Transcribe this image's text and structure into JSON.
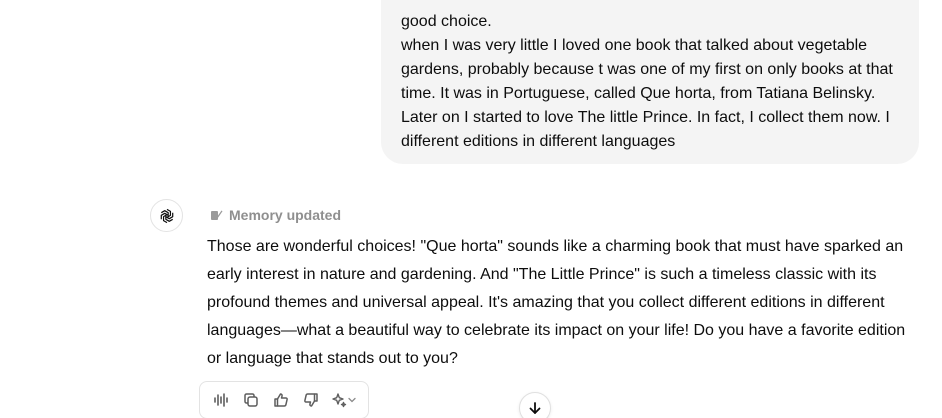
{
  "user_message": {
    "lines": [
      "good choice.",
      "when I was very little I loved one book that talked about vegetable",
      "gardens, probably because t was one of my first on only books at that",
      "time. It was in Portuguese, called Que horta, from Tatiana Belinsky.",
      "Later on I started to love The little Prince. In fact, I collect them now. I",
      "different editions in different languages"
    ]
  },
  "assistant": {
    "avatar_icon": "openai-logo-icon",
    "memory_label": "Memory updated",
    "response_lines": [
      "Those are wonderful choices! \"Que horta\" sounds like a charming book that must have sparked an",
      "early interest in nature and gardening. And \"The Little Prince\" is such a timeless classic with its",
      "profound themes and universal appeal. It's amazing that you collect different editions in different",
      "languages—what a beautiful way to celebrate its impact on your life! Do you have a favorite edition",
      "or language that stands out to you?"
    ]
  },
  "actions": {
    "items": [
      "read-aloud-icon",
      "copy-icon",
      "thumbs-up-icon",
      "thumbs-down-icon",
      "sparkle-regenerate-icon"
    ]
  },
  "scroll_button_icon": "arrow-down-icon",
  "colors": {
    "user_bubble_bg": "#f4f4f4",
    "text": "#0d0d0d",
    "muted": "#8f8f8f",
    "border": "#e3e3e3"
  }
}
